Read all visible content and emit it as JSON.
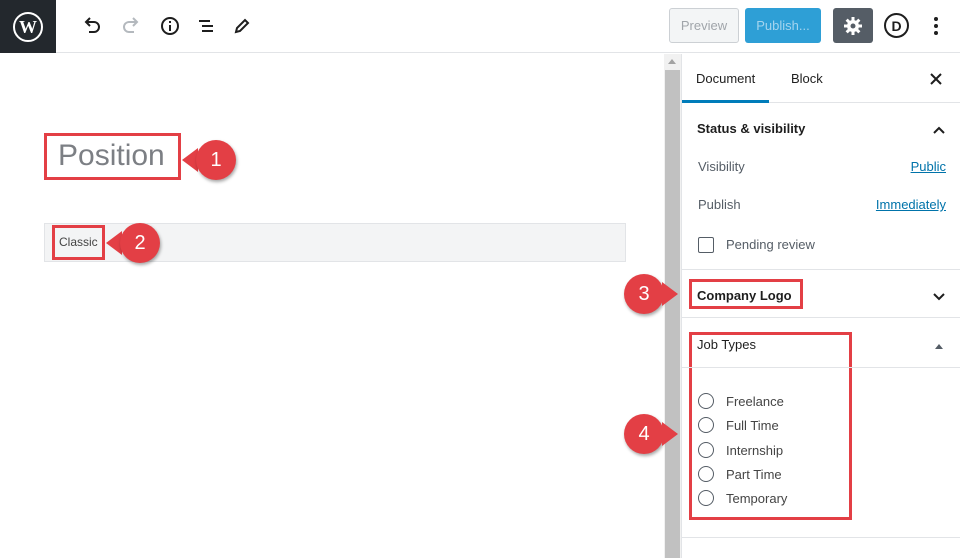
{
  "toolbar": {
    "preview_label": "Preview",
    "publish_label": "Publish...",
    "divi_label": "D",
    "icons": [
      "wordpress-icon",
      "undo-icon",
      "redo-icon",
      "info-icon",
      "list-view-icon",
      "edit-pencil-icon",
      "gear-icon",
      "more-vertical-icon"
    ]
  },
  "editor": {
    "title": "Position",
    "classic_label": "Classic"
  },
  "callouts": [
    "1",
    "2",
    "3",
    "4"
  ],
  "sidebar": {
    "tabs": [
      {
        "label": "Document",
        "active": true
      },
      {
        "label": "Block",
        "active": false
      }
    ],
    "status_visibility": {
      "title": "Status & visibility",
      "visibility_label": "Visibility",
      "visibility_value": "Public",
      "publish_label": "Publish",
      "publish_value": "Immediately",
      "pending_review_label": "Pending review"
    },
    "company_logo": {
      "title": "Company Logo"
    },
    "job_types": {
      "title": "Job Types",
      "options": [
        "Freelance",
        "Full Time",
        "Internship",
        "Part Time",
        "Temporary"
      ]
    }
  },
  "colors": {
    "accent": "#007cba",
    "publish_button": "#2e9fd6",
    "annotation_red": "#e33f45",
    "wp_logo_bg": "#23282d",
    "settings_button": "#555d66"
  }
}
